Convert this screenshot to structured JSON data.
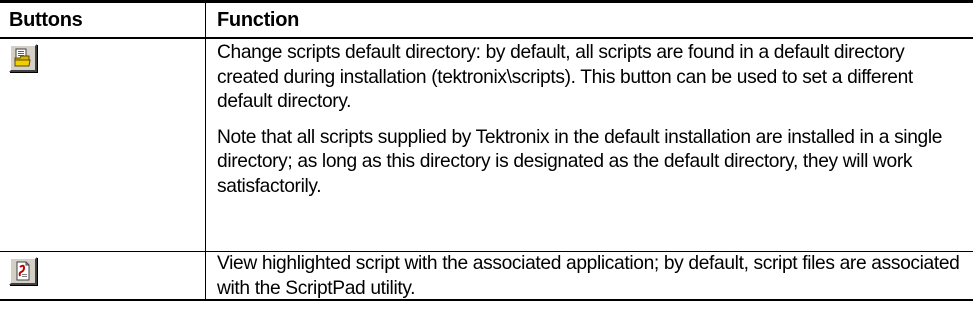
{
  "table": {
    "headers": {
      "buttons": "Buttons",
      "function": "Function"
    },
    "rows": [
      {
        "icon": "folder-directory-icon",
        "paragraphs": [
          "Change scripts default directory: by default, all scripts are found in a default directory created during installation (tektronix\\scripts). This button can be used to set a different default directory.",
          "Note that all scripts supplied by Tektronix in the default installation are installed in a single directory; as long as this directory is designated as the default directory, they will work satisfactorily."
        ]
      },
      {
        "icon": "view-script-icon",
        "paragraphs": [
          "View highlighted script with the associated application; by default, script files are associated with the ScriptPad utility."
        ]
      }
    ]
  },
  "colors": {
    "rule": "#000000",
    "button_face": "#d4d0c8"
  }
}
